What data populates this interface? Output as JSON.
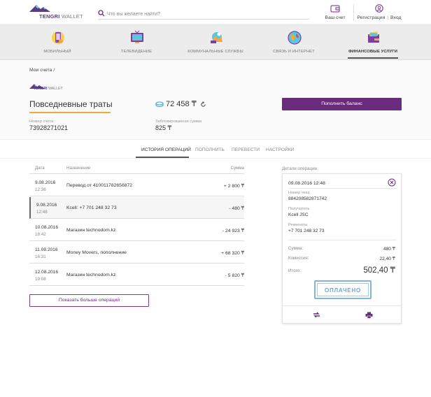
{
  "header": {
    "logo_brand": "TENGRI",
    "logo_product": "WALLET",
    "search_placeholder": "Что вы желаете найти?",
    "wallet_label": "Ваш счет",
    "register_label": "Регистрация",
    "login_label": "Вход",
    "separator": "|"
  },
  "categories": [
    {
      "label": "Мобильный",
      "icon": "mobile-icon"
    },
    {
      "label": "Телевидение",
      "icon": "tv-icon"
    },
    {
      "label": "Коммунальные службы",
      "icon": "utilities-icon"
    },
    {
      "label": "Связь и интернет",
      "icon": "globe-icon"
    },
    {
      "label": "Финансовые услуги",
      "icon": "wallet-icon",
      "active": true
    }
  ],
  "account": {
    "breadcrumb": "Мои счета /",
    "logo_brand": "TENGRI",
    "logo_product": "WALLET",
    "title": "Повседневные траты",
    "balance": "72 458 ₸",
    "topup_label": "Пополнить баланс",
    "number_label": "Номер счета",
    "number_value": "73928271021",
    "blocked_label": "Заблокированная сумма",
    "blocked_value": "825 ₸"
  },
  "tabs": [
    "История операций",
    "Пополнить",
    "Перевести",
    "Настройки"
  ],
  "operations": {
    "columns": {
      "date": "Дата",
      "purpose": "Назначение",
      "amount": "Сумма"
    },
    "rows": [
      {
        "date": "9.08.2016",
        "time": "12:36",
        "purpose": "Перевод от 410011782656872",
        "amount": "+ 2 800 ₸"
      },
      {
        "date": "9.08.2016",
        "time": "12:48",
        "purpose": "Kcell: +7 701 248 32 73",
        "amount": "- 480 ₸"
      },
      {
        "date": "10.08.2016",
        "time": "18:42",
        "purpose": "Магазин technodom.kz",
        "amount": "- 24 923 ₸"
      },
      {
        "date": "11.08.2016",
        "time": "16:31",
        "purpose": "Money Movers, пополнение",
        "amount": "+ 68 320 ₸"
      },
      {
        "date": "12.08.2016",
        "time": "19:08",
        "purpose": "Магазин technodom.kz",
        "amount": "- 5 820 ₸"
      }
    ],
    "more_label": "Показать больше операций"
  },
  "details": {
    "title": "Детали операции",
    "datetime": "09.08.2016 12:48",
    "receipt_label": "Номер чека",
    "receipt_value": "884208582871742",
    "recipient_label": "Получатель",
    "recipient_value": "Kcell JSC",
    "requisites_label": "Реквизиты",
    "requisites_value": "+7 701 248 32 73",
    "sum_label": "Сумма:",
    "sum_value": "480 ₸",
    "fee_label": "Комиссия:",
    "fee_value": "22,40 ₸",
    "total_label": "Итого:",
    "total_value": "502,40 ₸",
    "stamp": "ОПЛАЧЕНО"
  },
  "colors": {
    "accent": "#6b2b7c",
    "highlight": "#f2a93b",
    "stamp": "#7fb7d6"
  }
}
